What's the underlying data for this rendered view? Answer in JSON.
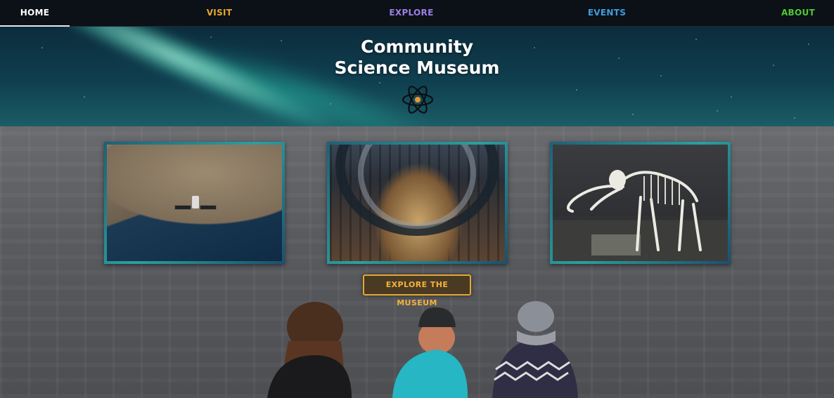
{
  "nav": {
    "items": [
      {
        "label": "HOME",
        "color": "#ffffff"
      },
      {
        "label": "VISIT",
        "color": "#e8a62e"
      },
      {
        "label": "EXPLORE",
        "color": "#9d7fe6"
      },
      {
        "label": "EVENTS",
        "color": "#3f9de0"
      },
      {
        "label": "ABOUT",
        "color": "#4ec934"
      }
    ]
  },
  "hero": {
    "title_line1": "Community",
    "title_line2": "Science Museum",
    "logo_icon": "atom-icon"
  },
  "cards": [
    {
      "image": "satellite-over-earth"
    },
    {
      "image": "museum-hall-arches"
    },
    {
      "image": "mammoth-skeleton"
    }
  ],
  "cta": {
    "label": "EXPLORE THE MUSEUM",
    "color": "#e3a834"
  }
}
